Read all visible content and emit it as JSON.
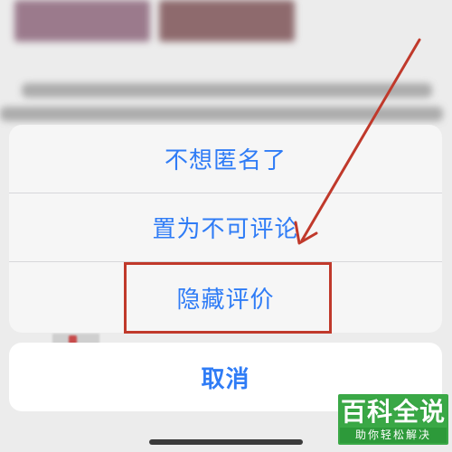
{
  "action_sheet": {
    "items": [
      {
        "label": "不想匿名了"
      },
      {
        "label": "置为不可评论"
      },
      {
        "label": "隐藏评价"
      }
    ],
    "cancel_label": "取消"
  },
  "colors": {
    "action_text": "#2f7cf6",
    "annotation_red": "#c0392b",
    "watermark_green": "#3aa846"
  },
  "watermark": {
    "title": "百科全说",
    "subtitle": "助你轻松解决"
  }
}
